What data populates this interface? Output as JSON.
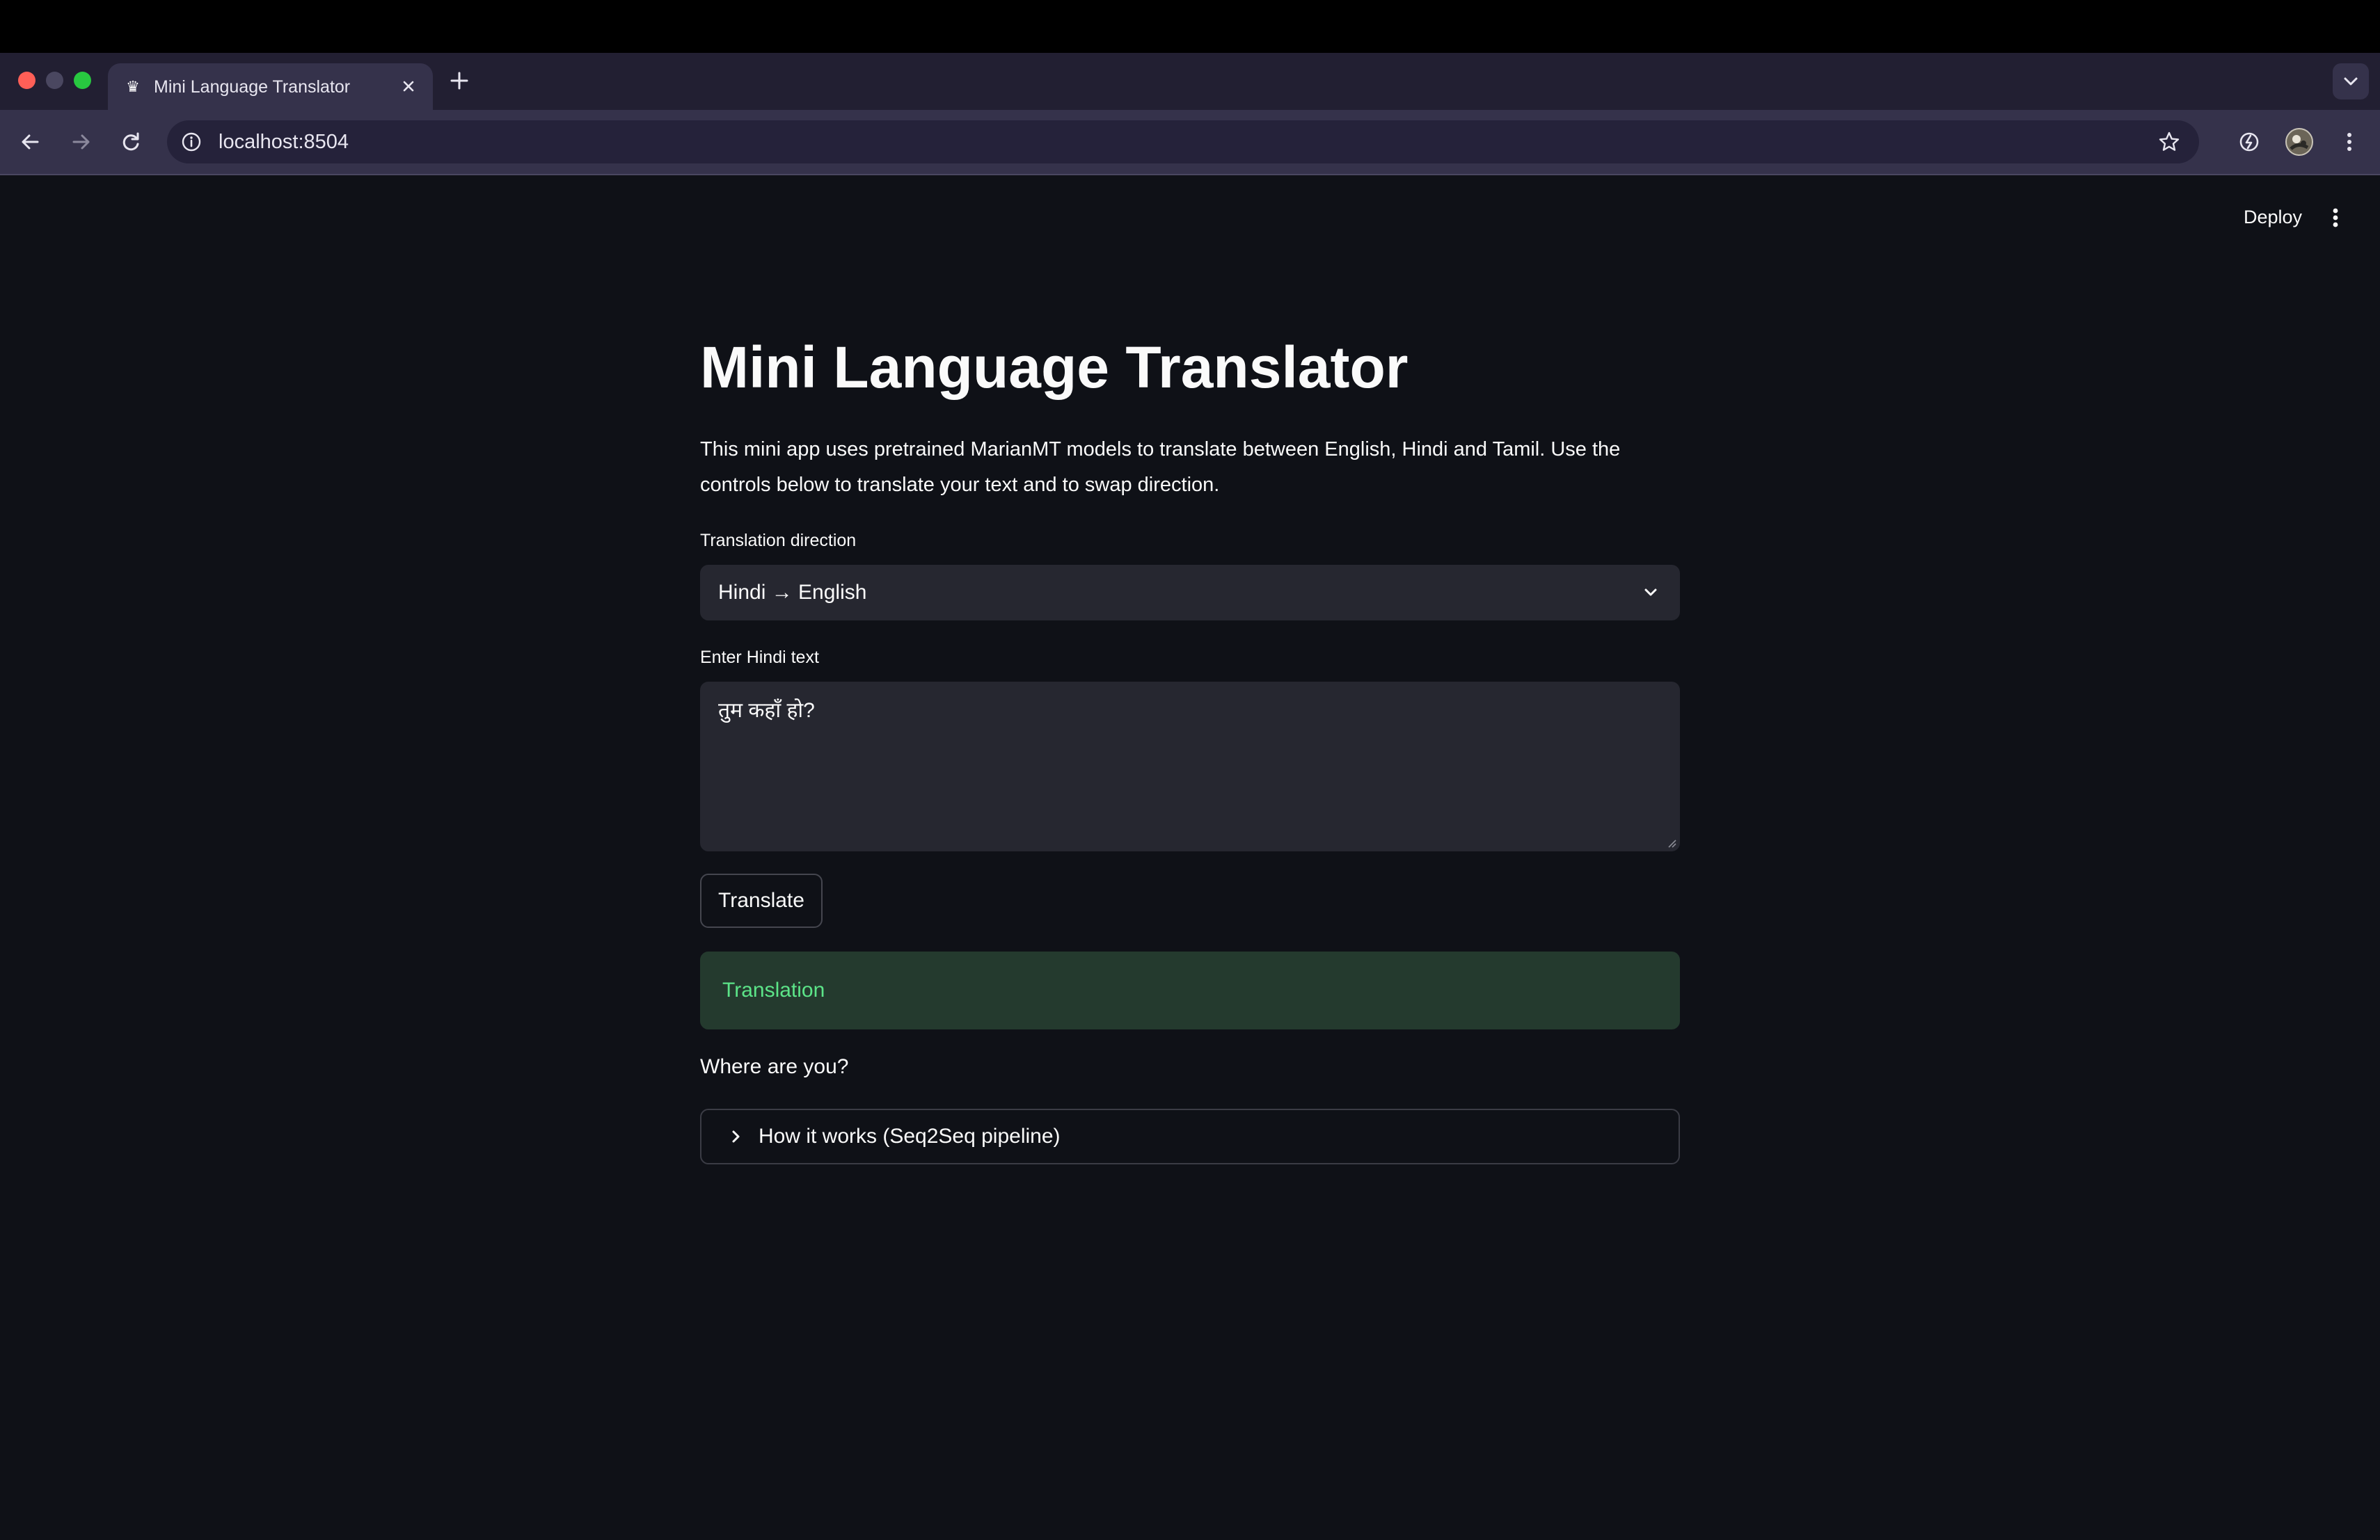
{
  "browser": {
    "tab": {
      "title": "Mini Language Translator",
      "favicon": "crown-icon",
      "close_icon": "close-icon"
    },
    "new_tab_icon": "plus-icon",
    "tabs_dropdown_icon": "chevron-down-icon",
    "nav": {
      "back_icon": "arrow-left-icon",
      "forward_icon": "arrow-right-icon",
      "reload_icon": "reload-icon"
    },
    "address_bar": {
      "url": "localhost:8504",
      "info_icon": "info-icon",
      "bookmark_icon": "star-icon"
    },
    "toolbar_icons": [
      "extension-icon",
      "profile-avatar",
      "kebab-menu-icon"
    ]
  },
  "app": {
    "header": {
      "deploy_label": "Deploy",
      "menu_icon": "kebab-menu-icon"
    },
    "title": "Mini Language Translator",
    "description": "This mini app uses pretrained MarianMT models to translate between English, Hindi and Tamil. Use the controls below to translate your text and to swap direction.",
    "direction": {
      "label": "Translation direction",
      "selected": "Hindi → English"
    },
    "input": {
      "label": "Enter Hindi text",
      "value": "तुम कहाँ हो?"
    },
    "translate_button": "Translate",
    "result": {
      "heading": "Translation",
      "text": "Where are you?"
    },
    "expander": {
      "label": "How it works (Seq2Seq pipeline)"
    }
  },
  "colors": {
    "page_background": "#0f1117",
    "input_background": "#262730",
    "success_background": "#243a2e",
    "success_text": "#5ce488",
    "tabstrip": "#221f32",
    "toolbar": "#35324b"
  }
}
